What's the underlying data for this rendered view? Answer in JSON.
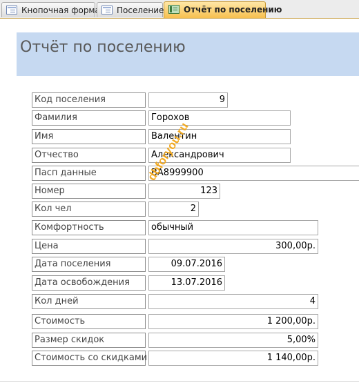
{
  "tabs": [
    {
      "label": "Кнопочная форма",
      "icon": "form-icon"
    },
    {
      "label": "Поселение",
      "icon": "form-icon"
    },
    {
      "label": "Отчёт по поселению",
      "icon": "report-icon",
      "active": true
    }
  ],
  "report": {
    "title": "Отчёт по поселению",
    "fields": [
      {
        "label": "Код поселения",
        "value": "9"
      },
      {
        "label": "Фамилия",
        "value": "Горохов"
      },
      {
        "label": "Имя",
        "value": "Валентин"
      },
      {
        "label": "Отчество",
        "value": "Александрович"
      },
      {
        "label": "Пасп данные",
        "value": "ВА8999900"
      },
      {
        "label": "Номер",
        "value": "123"
      },
      {
        "label": "Кол чел",
        "value": "2"
      },
      {
        "label": "Комфортность",
        "value": "обычный"
      },
      {
        "label": "Цена",
        "value": "300,00р."
      },
      {
        "label": "Дата поселения",
        "value": "09.07.2016"
      },
      {
        "label": "Дата освобождения",
        "value": "13.07.2016"
      },
      {
        "label": "Кол дней",
        "value": "4"
      },
      {
        "label": "Стоимость",
        "value": "1 200,00р."
      },
      {
        "label": "Размер скидок",
        "value": "5,00%"
      },
      {
        "label": "Стоимость со скидками",
        "value": "1 140,00р."
      }
    ]
  },
  "watermark": "dbforyou.ru",
  "colors": {
    "header_bg": "#c6d9f1",
    "active_tab": "#f7c04f",
    "watermark": "#f2a71b"
  }
}
